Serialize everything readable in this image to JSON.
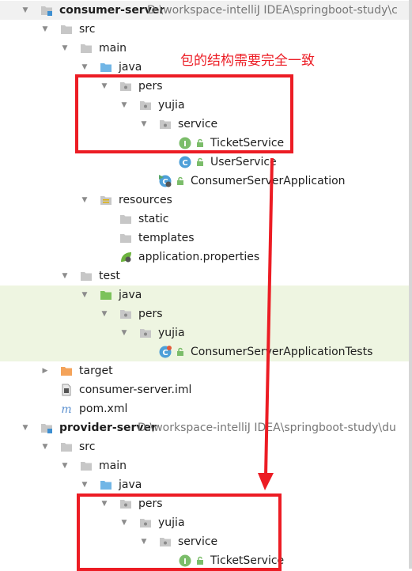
{
  "colors": {
    "annotation_red": "#ec1c24",
    "folder_gray": "#c7c7c7",
    "source_folder_blue": "#71b6e6",
    "test_folder_green": "#7cc25b",
    "excluded_orange": "#f4a35a",
    "interface_green": "#7bbd6a",
    "class_blue": "#4d9fd8",
    "test_highlight": "#eef5e1"
  },
  "annotation": {
    "text": "包的结构需要完全一致"
  },
  "rows": [
    {
      "label": "consumer-server",
      "path": "D:\\workspace-intelliJ IDEA\\springboot-study\\c",
      "depth": 0,
      "arrow": "down",
      "icon": "module-folder-icon",
      "bold": true,
      "bg": "gray"
    },
    {
      "label": "src",
      "depth": 1,
      "arrow": "down",
      "icon": "folder-icon"
    },
    {
      "label": "main",
      "depth": 2,
      "arrow": "down",
      "icon": "folder-icon"
    },
    {
      "label": "java",
      "depth": 3,
      "arrow": "down",
      "icon": "source-folder-icon"
    },
    {
      "label": "pers",
      "depth": 4,
      "arrow": "down",
      "icon": "package-icon"
    },
    {
      "label": "yujia",
      "depth": 5,
      "arrow": "down",
      "icon": "package-icon"
    },
    {
      "label": "service",
      "depth": 6,
      "arrow": "down",
      "icon": "package-icon"
    },
    {
      "label": "TicketService",
      "depth": 7,
      "arrow": "",
      "icon": "interface-icon",
      "lock": true
    },
    {
      "label": "UserService",
      "depth": 7,
      "arrow": "",
      "icon": "class-icon",
      "lock": true
    },
    {
      "label": "ConsumerServerApplication",
      "depth": 6,
      "arrow": "",
      "icon": "spring-boot-run-icon",
      "lock": true
    },
    {
      "label": "resources",
      "depth": 3,
      "arrow": "down",
      "icon": "resources-folder-icon"
    },
    {
      "label": "static",
      "depth": 4,
      "arrow": "",
      "icon": "folder-icon"
    },
    {
      "label": "templates",
      "depth": 4,
      "arrow": "",
      "icon": "folder-icon"
    },
    {
      "label": "application.properties",
      "depth": 4,
      "arrow": "",
      "icon": "spring-leaf-icon"
    },
    {
      "label": "test",
      "depth": 2,
      "arrow": "down",
      "icon": "folder-icon"
    },
    {
      "label": "java",
      "depth": 3,
      "arrow": "down",
      "icon": "test-folder-icon",
      "bg": "test"
    },
    {
      "label": "pers",
      "depth": 4,
      "arrow": "down",
      "icon": "package-icon",
      "bg": "test"
    },
    {
      "label": "yujia",
      "depth": 5,
      "arrow": "down",
      "icon": "package-icon",
      "bg": "test"
    },
    {
      "label": "ConsumerServerApplicationTests",
      "depth": 6,
      "arrow": "",
      "icon": "test-class-icon",
      "lock": true,
      "bg": "test"
    },
    {
      "label": "target",
      "depth": 1,
      "arrow": "right",
      "icon": "excluded-folder-icon"
    },
    {
      "label": "consumer-server.iml",
      "depth": 1,
      "arrow": "",
      "icon": "iml-file-icon"
    },
    {
      "label": "pom.xml",
      "depth": 1,
      "arrow": "",
      "icon": "maven-icon"
    },
    {
      "label": "provider-server",
      "path": "D:\\workspace-intelliJ IDEA\\springboot-study\\du",
      "depth": 0,
      "arrow": "down",
      "icon": "module-folder-icon",
      "bold": true
    },
    {
      "label": "src",
      "depth": 1,
      "arrow": "down",
      "icon": "folder-icon"
    },
    {
      "label": "main",
      "depth": 2,
      "arrow": "down",
      "icon": "folder-icon"
    },
    {
      "label": "java",
      "depth": 3,
      "arrow": "down",
      "icon": "source-folder-icon"
    },
    {
      "label": "pers",
      "depth": 4,
      "arrow": "down",
      "icon": "package-icon"
    },
    {
      "label": "yujia",
      "depth": 5,
      "arrow": "down",
      "icon": "package-icon"
    },
    {
      "label": "service",
      "depth": 6,
      "arrow": "down",
      "icon": "package-icon"
    },
    {
      "label": "TicketService",
      "depth": 7,
      "arrow": "",
      "icon": "interface-icon",
      "lock": true
    }
  ]
}
